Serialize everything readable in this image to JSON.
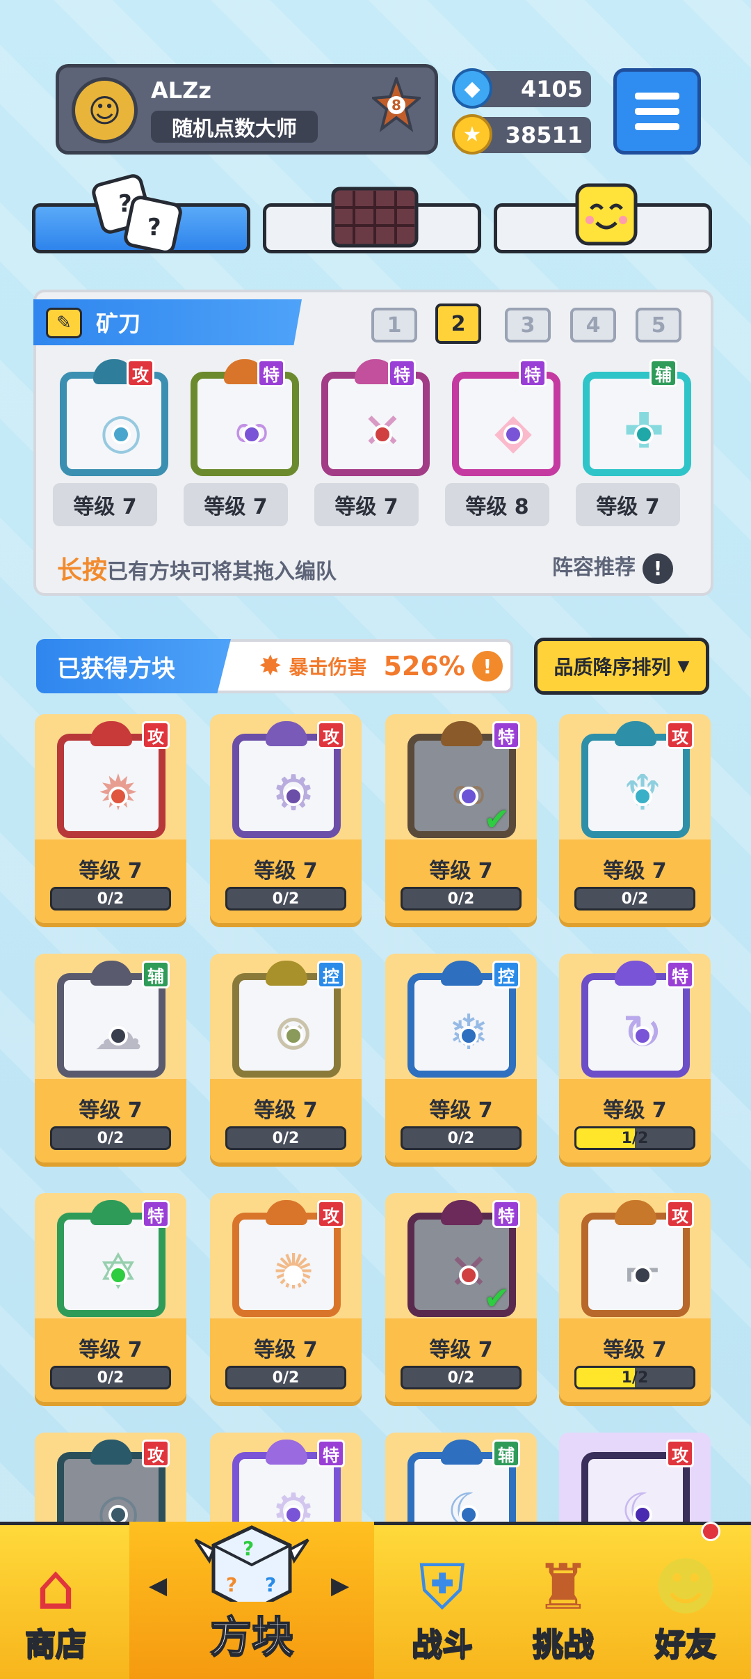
{
  "player": {
    "name": "ALZz",
    "title": "随机点数大师",
    "rank": "8"
  },
  "currency": {
    "gems": "4105",
    "coins": "38511"
  },
  "tabs": [
    {
      "name": "dice",
      "active": true
    },
    {
      "name": "board",
      "active": false
    },
    {
      "name": "emoji",
      "active": false
    }
  ],
  "team": {
    "name": "矿刀",
    "slots": [
      "1",
      "2",
      "3",
      "4",
      "5"
    ],
    "selected_slot": "2",
    "cards": [
      {
        "tag": "攻",
        "level": "等级 7"
      },
      {
        "tag": "特",
        "level": "等级 7"
      },
      {
        "tag": "特",
        "level": "等级 7"
      },
      {
        "tag": "特",
        "level": "等级 8"
      },
      {
        "tag": "辅",
        "level": "等级 7"
      }
    ],
    "hint_highlight": "长按",
    "hint_text": "已有方块可将其拖入编队",
    "recommend": "阵容推荐",
    "recommend_icon": "!"
  },
  "owned": {
    "title": "已获得方块",
    "crit_label": "暴击伤害",
    "crit_value": "526%",
    "crit_icon": "!",
    "sort_label": "品质降序排列",
    "sort_arrow": "▼",
    "cards": [
      {
        "tag": "攻",
        "level": "等级 7",
        "progress": "0/2",
        "fill": 0
      },
      {
        "tag": "攻",
        "level": "等级 7",
        "progress": "0/2",
        "fill": 0
      },
      {
        "tag": "特",
        "level": "等级 7",
        "progress": "0/2",
        "fill": 0
      },
      {
        "tag": "攻",
        "level": "等级 7",
        "progress": "0/2",
        "fill": 0
      },
      {
        "tag": "辅",
        "level": "等级 7",
        "progress": "0/2",
        "fill": 0
      },
      {
        "tag": "控",
        "level": "等级 7",
        "progress": "0/2",
        "fill": 0
      },
      {
        "tag": "控",
        "level": "等级 7",
        "progress": "0/2",
        "fill": 0
      },
      {
        "tag": "特",
        "level": "等级 7",
        "progress": "1/2",
        "fill": 0.5
      },
      {
        "tag": "特",
        "level": "等级 7",
        "progress": "0/2",
        "fill": 0
      },
      {
        "tag": "攻",
        "level": "等级 7",
        "progress": "0/2",
        "fill": 0
      },
      {
        "tag": "特",
        "level": "等级 7",
        "progress": "0/2",
        "fill": 0
      },
      {
        "tag": "攻",
        "level": "等级 7",
        "progress": "1/2",
        "fill": 0.5
      },
      {
        "tag": "攻"
      },
      {
        "tag": "特"
      },
      {
        "tag": "辅"
      },
      {
        "tag": "攻"
      }
    ]
  },
  "nav": {
    "shop": "商店",
    "dice": "方块",
    "battle": "战斗",
    "challenge": "挑战",
    "friends": "好友"
  },
  "colors": {
    "accent_blue": "#2f86ee",
    "accent_yellow": "#ffd23a",
    "attack_tag": "#e0353d",
    "special_tag": "#9a3fd6",
    "support_tag": "#2e9b59",
    "control_tag": "#2a8be8"
  }
}
